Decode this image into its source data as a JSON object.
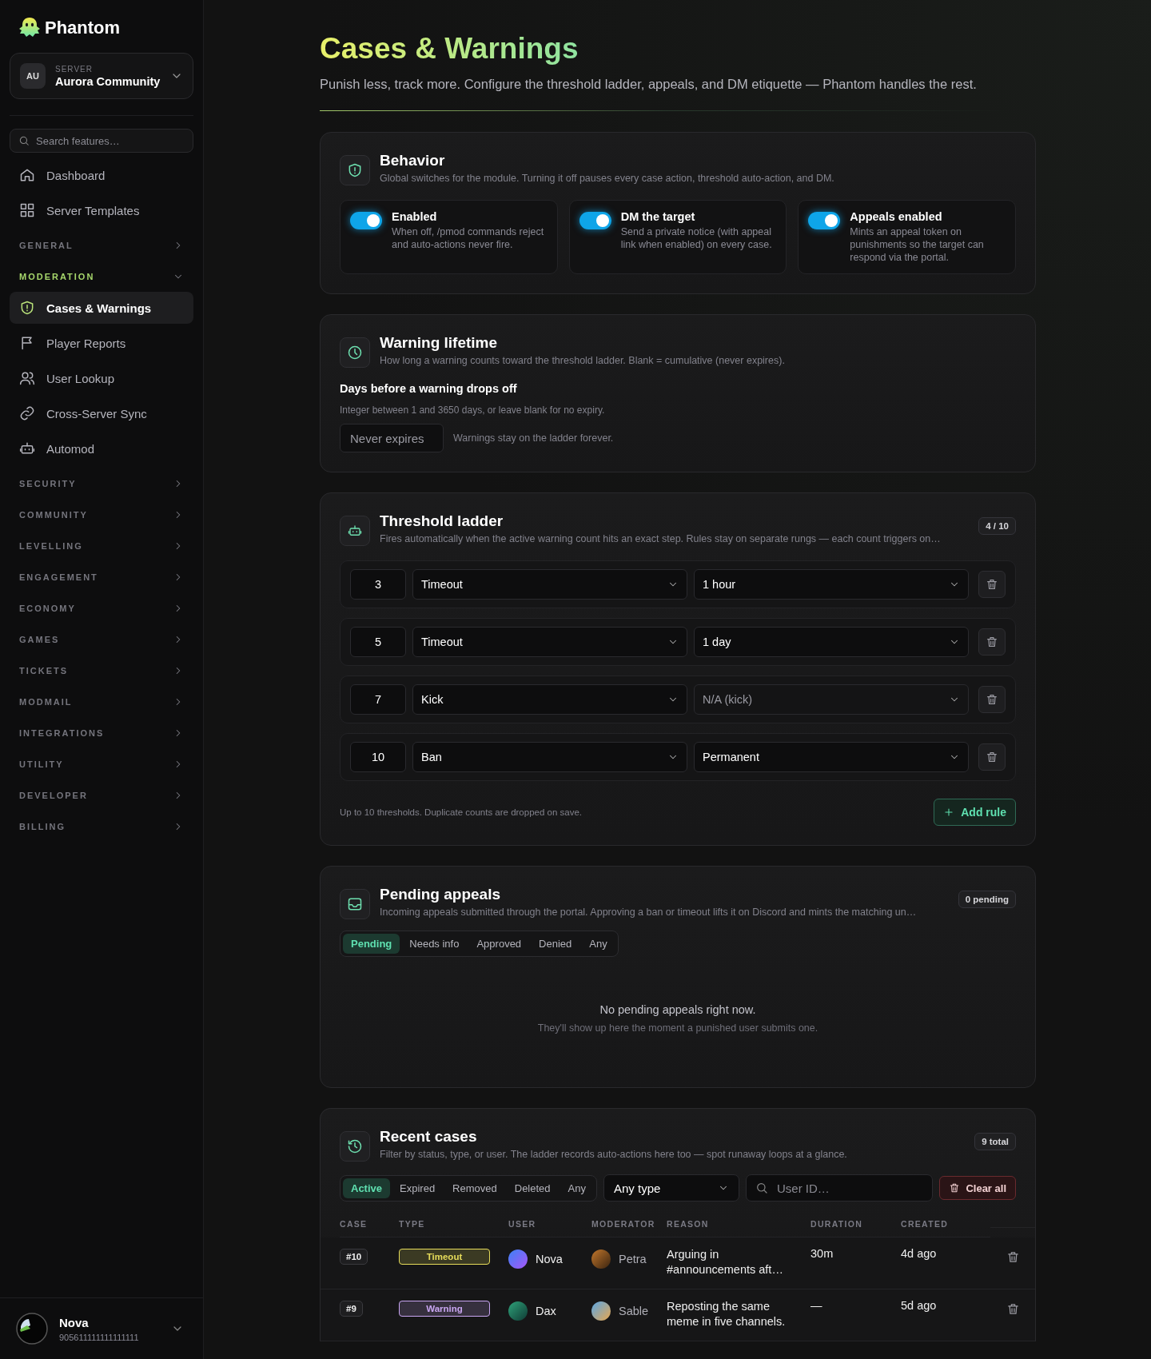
{
  "brand": {
    "name": "Phantom"
  },
  "server": {
    "label": "SERVER",
    "initials": "AU",
    "name": "Aurora Community"
  },
  "search": {
    "placeholder": "Search features…"
  },
  "nav": [
    {
      "kind": "item",
      "label": "Dashboard",
      "selected": false
    },
    {
      "kind": "item",
      "label": "Server Templates",
      "selected": false
    },
    {
      "kind": "section",
      "label": "GENERAL",
      "expanded": false
    },
    {
      "kind": "section",
      "label": "MODERATION",
      "expanded": true,
      "children": [
        {
          "kind": "item",
          "label": "Cases & Warnings",
          "selected": true
        },
        {
          "kind": "item",
          "label": "Player Reports",
          "selected": false
        },
        {
          "kind": "item",
          "label": "User Lookup",
          "selected": false
        },
        {
          "kind": "item",
          "label": "Cross-Server Sync",
          "selected": false
        },
        {
          "kind": "item",
          "label": "Automod",
          "selected": false
        }
      ]
    },
    {
      "kind": "section",
      "label": "SECURITY",
      "expanded": false
    },
    {
      "kind": "section",
      "label": "COMMUNITY",
      "expanded": false
    },
    {
      "kind": "section",
      "label": "LEVELLING",
      "expanded": false
    },
    {
      "kind": "section",
      "label": "ENGAGEMENT",
      "expanded": false
    },
    {
      "kind": "section",
      "label": "ECONOMY",
      "expanded": false
    },
    {
      "kind": "section",
      "label": "GAMES",
      "expanded": false
    },
    {
      "kind": "section",
      "label": "TICKETS",
      "expanded": false
    },
    {
      "kind": "section",
      "label": "MODMAIL",
      "expanded": false
    },
    {
      "kind": "section",
      "label": "INTEGRATIONS",
      "expanded": false
    },
    {
      "kind": "section",
      "label": "UTILITY",
      "expanded": false
    },
    {
      "kind": "section",
      "label": "DEVELOPER",
      "expanded": false
    },
    {
      "kind": "section",
      "label": "BILLING",
      "expanded": false
    }
  ],
  "user": {
    "name": "Nova",
    "id": "905611111111111111"
  },
  "page": {
    "title": "Cases & Warnings",
    "subtitle": "Punish less, track more. Configure the threshold ladder, appeals, and DM etiquette — Phantom handles the rest."
  },
  "behavior": {
    "title": "Behavior",
    "description": "Global switches for the module. Turning it off pauses every case action, threshold auto-action, and DM.",
    "toggles": [
      {
        "label": "Enabled",
        "description": "When off, /pmod commands reject and auto-actions never fire.",
        "on": true
      },
      {
        "label": "DM the target",
        "description": "Send a private notice (with appeal link when enabled) on every case.",
        "on": true
      },
      {
        "label": "Appeals enabled",
        "description": "Mints an appeal token on punishments so the target can respond via the portal.",
        "on": true
      }
    ]
  },
  "lifetime": {
    "title": "Warning lifetime",
    "description": "How long a warning counts toward the threshold ladder. Blank = cumulative (never expires).",
    "field_label": "Days before a warning drops off",
    "hint": "Integer between 1 and 3650 days, or leave blank for no expiry.",
    "placeholder": "Never expires",
    "note": "Warnings stay on the ladder forever."
  },
  "ladder": {
    "title": "Threshold ladder",
    "description": "Fires automatically when the active warning count hits an exact step. Rules stay on separate rungs — each count triggers on…",
    "badge": "4 / 10",
    "rules": [
      {
        "count": "3",
        "action": "Timeout",
        "duration": "1 hour",
        "duration_disabled": false
      },
      {
        "count": "5",
        "action": "Timeout",
        "duration": "1 day",
        "duration_disabled": false
      },
      {
        "count": "7",
        "action": "Kick",
        "duration": "N/A (kick)",
        "duration_disabled": true
      },
      {
        "count": "10",
        "action": "Ban",
        "duration": "Permanent",
        "duration_disabled": false
      }
    ],
    "footnote": "Up to 10 thresholds. Duplicate counts are dropped on save.",
    "add_button": "Add rule"
  },
  "appeals": {
    "title": "Pending appeals",
    "description": "Incoming appeals submitted through the portal. Approving a ban or timeout lifts it on Discord and mints the matching un…",
    "badge": "0 pending",
    "tabs": [
      {
        "label": "Pending",
        "selected": true
      },
      {
        "label": "Needs info",
        "selected": false
      },
      {
        "label": "Approved",
        "selected": false
      },
      {
        "label": "Denied",
        "selected": false
      },
      {
        "label": "Any",
        "selected": false
      }
    ],
    "empty_title": "No pending appeals right now.",
    "empty_text": "They'll show up here the moment a punished user submits one."
  },
  "cases": {
    "title": "Recent cases",
    "description": "Filter by status, type, or user. The ladder records auto-actions here too — spot runaway loops at a glance.",
    "badge": "9 total",
    "tabs": [
      {
        "label": "Active",
        "selected": true
      },
      {
        "label": "Expired",
        "selected": false
      },
      {
        "label": "Removed",
        "selected": false
      },
      {
        "label": "Deleted",
        "selected": false
      },
      {
        "label": "Any",
        "selected": false
      }
    ],
    "type_filter": "Any type",
    "search_placeholder": "User ID…",
    "clear_button": "Clear all",
    "columns": [
      "CASE",
      "TYPE",
      "USER",
      "MODERATOR",
      "REASON",
      "DURATION",
      "CREATED"
    ],
    "rows": [
      {
        "case": "#10",
        "type": "Timeout",
        "color": "#e6dc5a",
        "user": "Nova",
        "moderator": "Petra",
        "reason": "Arguing in #announcements aft…",
        "duration": "30m",
        "created": "4d ago"
      },
      {
        "case": "#9",
        "type": "Warning",
        "color": "#c9a6f2",
        "user": "Dax",
        "moderator": "Sable",
        "reason": "Reposting the same meme in five channels.",
        "duration": "—",
        "created": "5d ago"
      }
    ]
  }
}
